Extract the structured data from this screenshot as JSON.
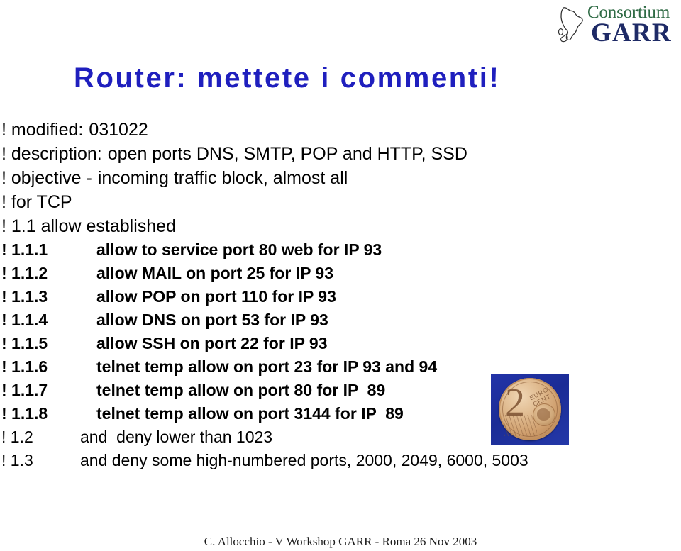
{
  "slide": {
    "title": "Router: mettete i commenti!",
    "title_color": "#1F1FBE",
    "background_color": "#FFFFFF",
    "footer": "C. Allocchio - V Workshop GARR - Roma 26 Nov 2003"
  },
  "logo": {
    "word_top": "Consortium",
    "word_bottom": "GARR",
    "color_top": "#2F6B45",
    "color_bottom": "#1E2A66",
    "map_icon": "italy-map-outline-icon"
  },
  "config_lines": [
    {
      "label": "! modified:",
      "text": "031022",
      "style": "big"
    },
    {
      "label": "! description:",
      "text": "open ports DNS, SMTP, POP and HTTP, SSD",
      "style": "big"
    },
    {
      "label": "! objective -",
      "text": "incoming traffic block, almost all",
      "style": "big"
    },
    {
      "label": "! for TCP",
      "text": "",
      "style": "big"
    },
    {
      "label": "! 1.1 allow established",
      "text": "",
      "style": "big"
    },
    {
      "label": "! 1.1.1",
      "text": "allow to service port 80 web for IP 93",
      "style": "sub"
    },
    {
      "label": "! 1.1.2",
      "text": "allow MAIL on port 25 for IP 93",
      "style": "sub"
    },
    {
      "label": "! 1.1.3",
      "text": "allow POP on port 110 for IP 93",
      "style": "sub"
    },
    {
      "label": "! 1.1.4",
      "text": "allow DNS on port 53 for IP 93",
      "style": "sub"
    },
    {
      "label": "! 1.1.5",
      "text": "allow SSH on port 22 for IP 93",
      "style": "sub"
    },
    {
      "label": "! 1.1.6",
      "text": "telnet temp allow on port 23 for IP 93 and 94",
      "style": "sub"
    },
    {
      "label": "! 1.1.7",
      "text": "telnet temp allow on port 80 for IP  89",
      "style": "sub"
    },
    {
      "label": "! 1.1.8",
      "text": "telnet temp allow on port 3144 for IP  89",
      "style": "sub"
    },
    {
      "label": "! 1.2",
      "text": "and  deny lower than 1023",
      "style": "sub2"
    },
    {
      "label": "! 1.3",
      "text": "and deny some high-numbered ports, 2000, 2049, 6000, 5003",
      "style": "sub2"
    }
  ],
  "coin_image": {
    "alt": "two-euro-cent-coin-photo",
    "denomination": "2",
    "currency_text": "EURO CENT",
    "background_color": "#1F2FA0"
  }
}
